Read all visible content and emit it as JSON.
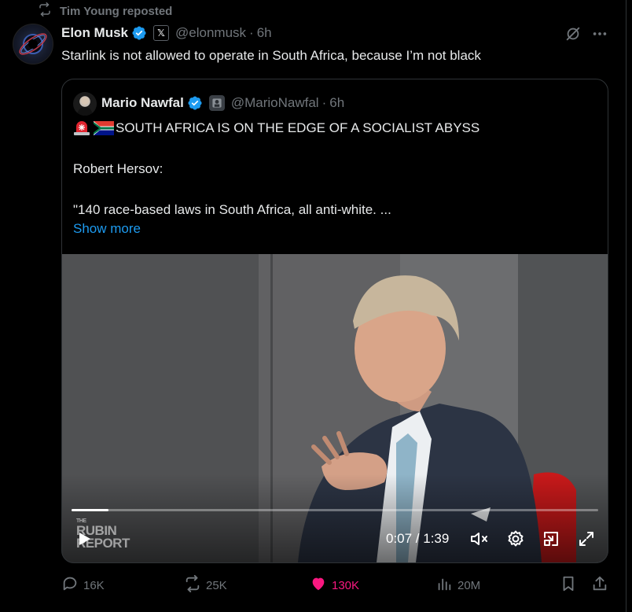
{
  "repost": {
    "text": "Tim Young reposted"
  },
  "tweet": {
    "author_name": "Elon Musk",
    "handle": "@elonmusk",
    "separator": "·",
    "time": "6h",
    "text": "Starlink is not allowed to operate in South Africa, because I’m not black"
  },
  "quote": {
    "author_name": "Mario Nawfal",
    "handle": "@MarioNawfal",
    "separator": "·",
    "time": "6h",
    "headline": "SOUTH AFRICA IS ON THE EDGE OF A SOCIALIST ABYSS",
    "line2": "Robert Hersov:",
    "line3": "\"140 race-based laws in South Africa, all anti-white. ...",
    "show_more": "Show more"
  },
  "video": {
    "watermark_top": "THE",
    "watermark_main1": "RUBIN",
    "watermark_main2": "REPORT",
    "time_readout": "0:07 / 1:39",
    "progress_fraction": 0.07
  },
  "actions": {
    "replies": "16K",
    "reposts": "25K",
    "likes": "130K",
    "views": "20M"
  },
  "colors": {
    "background": "#000000",
    "text": "#e7e9ea",
    "muted": "#71767b",
    "link": "#1d9bf0",
    "like": "#f91880",
    "border": "#2f3336"
  },
  "icons": [
    "repost-icon",
    "verified-icon",
    "x-badge-icon",
    "grok-icon",
    "more-icon",
    "siren-icon",
    "south-africa-flag-icon",
    "play-icon",
    "mute-icon",
    "settings-icon",
    "pip-icon",
    "fullscreen-icon",
    "reply-icon",
    "views-icon",
    "bookmark-icon",
    "share-icon",
    "heart-icon"
  ]
}
